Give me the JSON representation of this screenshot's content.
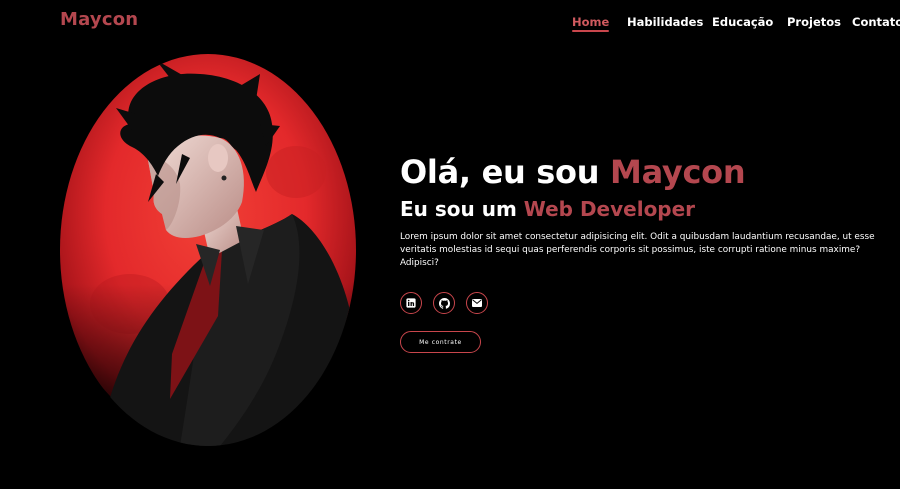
{
  "brand": {
    "name": "Maycon"
  },
  "nav": {
    "items": [
      {
        "label": "Home",
        "active": true
      },
      {
        "label": "Habilidades",
        "active": false
      },
      {
        "label": "Educação",
        "active": false
      },
      {
        "label": "Projetos",
        "active": false
      },
      {
        "label": "Contato",
        "active": false
      }
    ]
  },
  "hero": {
    "greeting": "Olá, eu sou ",
    "name": "Maycon",
    "role_prefix": "Eu sou um ",
    "role": "Web Developer",
    "description": "Lorem ipsum dolor sit amet consectetur adipisicing elit. Odit a quibusdam laudantium recusandae, ut esse veritatis molestias id sequi quas perferendis corporis sit possimus, iste corrupti ratione minus maxime? Adipisci?",
    "socials": [
      {
        "icon": "linkedin-icon"
      },
      {
        "icon": "github-icon"
      },
      {
        "icon": "mail-icon"
      }
    ],
    "cta_label": "Me contrate"
  },
  "colors": {
    "background": "#000000",
    "accent": "#b4474f",
    "accent_border": "#c9464c",
    "moon": "#e3292b"
  }
}
